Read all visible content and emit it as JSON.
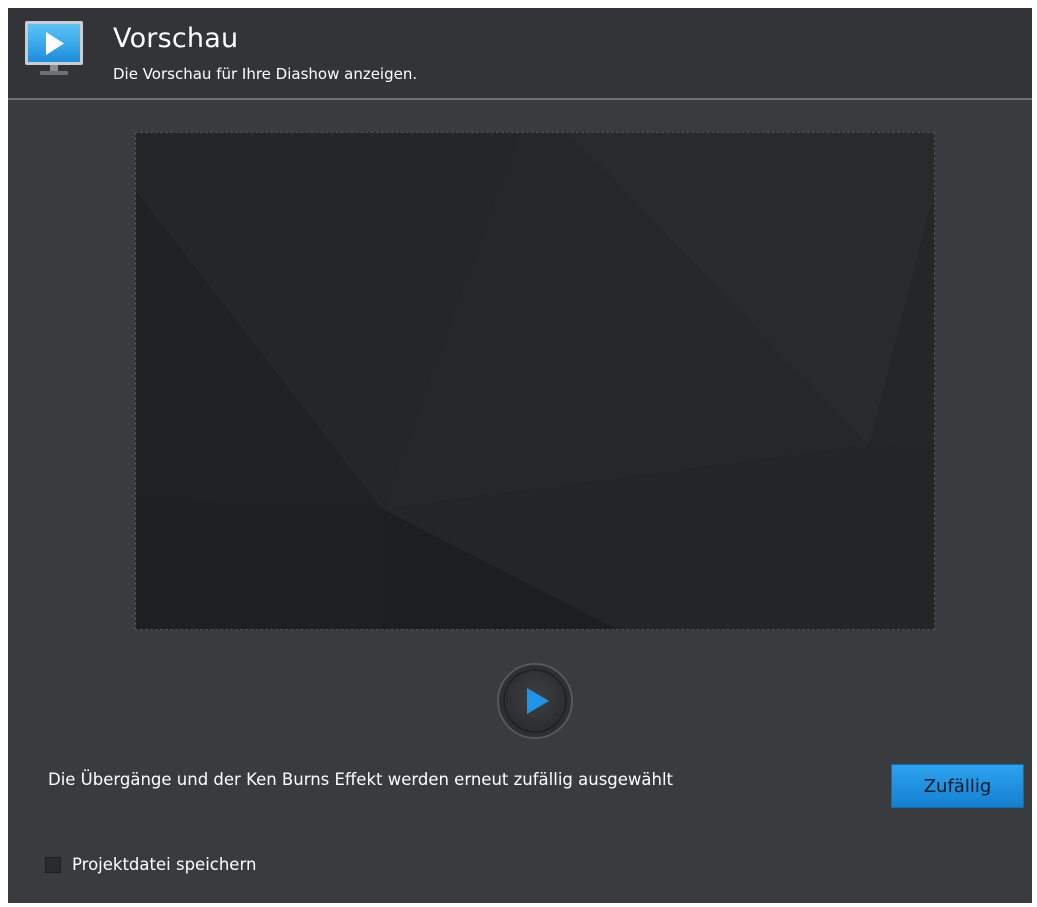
{
  "header": {
    "title": "Vorschau",
    "subtitle": "Die Vorschau für Ihre Diashow anzeigen.",
    "icon": "monitor-play-icon"
  },
  "preview": {
    "play_icon": "play-icon"
  },
  "info": {
    "text": "Die Übergänge und der Ken Burns Effekt werden erneut zufällig ausgewählt"
  },
  "random_button": {
    "label": "Zufällig"
  },
  "save_project": {
    "label": "Projektdatei speichern",
    "checked": false
  },
  "colors": {
    "accent": "#1e90e6",
    "background": "#3a3b3e",
    "header_background": "#333437"
  }
}
